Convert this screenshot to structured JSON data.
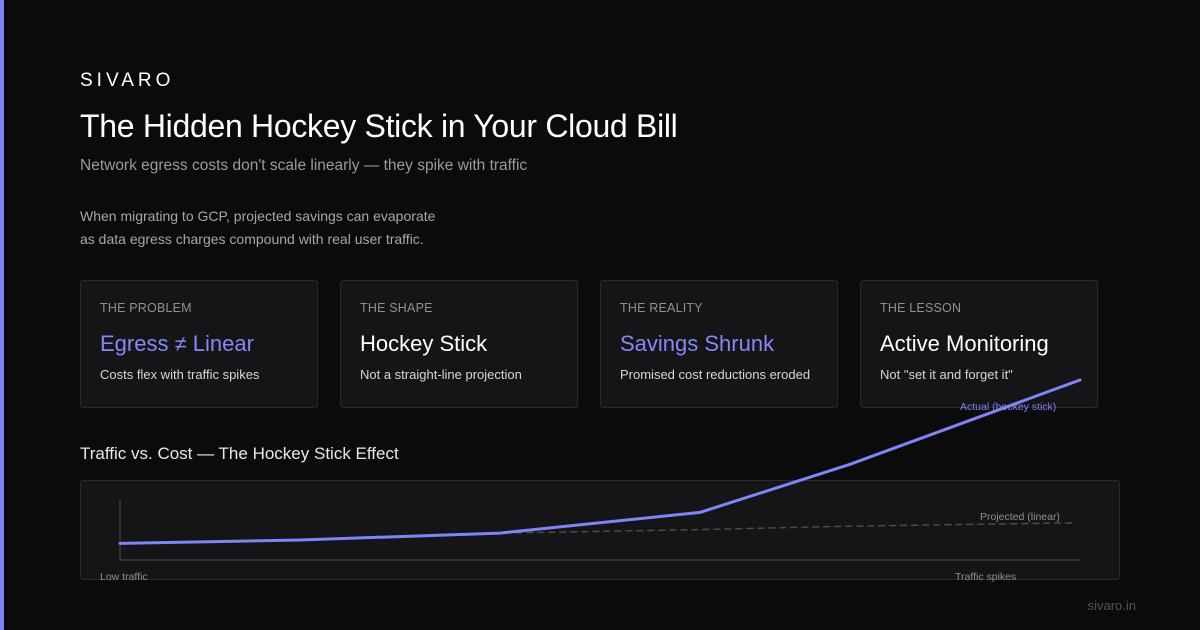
{
  "brand": "SIVARO",
  "title": "The Hidden Hockey Stick in Your Cloud Bill",
  "subtitle": "Network egress costs don't scale linearly — they spike with traffic",
  "intro": [
    "When migrating to GCP, projected savings can evaporate",
    "as data egress charges compound with real user traffic."
  ],
  "cards": [
    {
      "label": "THE PROBLEM",
      "value": "Egress ≠ Linear",
      "desc": "Costs flex with traffic spikes",
      "accent": true
    },
    {
      "label": "THE SHAPE",
      "value": "Hockey Stick",
      "desc": "Not a straight-line projection",
      "accent": false
    },
    {
      "label": "THE REALITY",
      "value": "Savings Shrunk",
      "desc": "Promised cost reductions eroded",
      "accent": true
    },
    {
      "label": "THE LESSON",
      "value": "Active Monitoring",
      "desc": "Not \"set it and forget it\"",
      "accent": false
    }
  ],
  "chart_title": "Traffic vs. Cost — The Hockey Stick Effect",
  "chart_data": {
    "type": "line",
    "title": "Traffic vs. Cost — The Hockey Stick Effect",
    "x_start_label": "Low traffic",
    "x_end_label": "Traffic spikes",
    "x": [
      0,
      1,
      2,
      3,
      4,
      5
    ],
    "xlim": [
      0,
      5
    ],
    "ylim": [
      0,
      100
    ],
    "series": [
      {
        "name": "Actual (hockey stick)",
        "values": [
          5,
          7,
          11,
          23,
          51,
          100
        ],
        "color": "#7f85f5",
        "style": "solid"
      },
      {
        "name": "Projected (linear)",
        "values": [
          5,
          7,
          11,
          13,
          15,
          17
        ],
        "color": "#4a4a50",
        "style": "dashed"
      }
    ],
    "grid": false,
    "legend": "inline labels at line ends"
  },
  "footer": "sivaro.in",
  "colors": {
    "background": "#0b0b0c",
    "accent": "#7f85f5",
    "card_bg": "#151517",
    "card_border": "#2a2a2e"
  }
}
